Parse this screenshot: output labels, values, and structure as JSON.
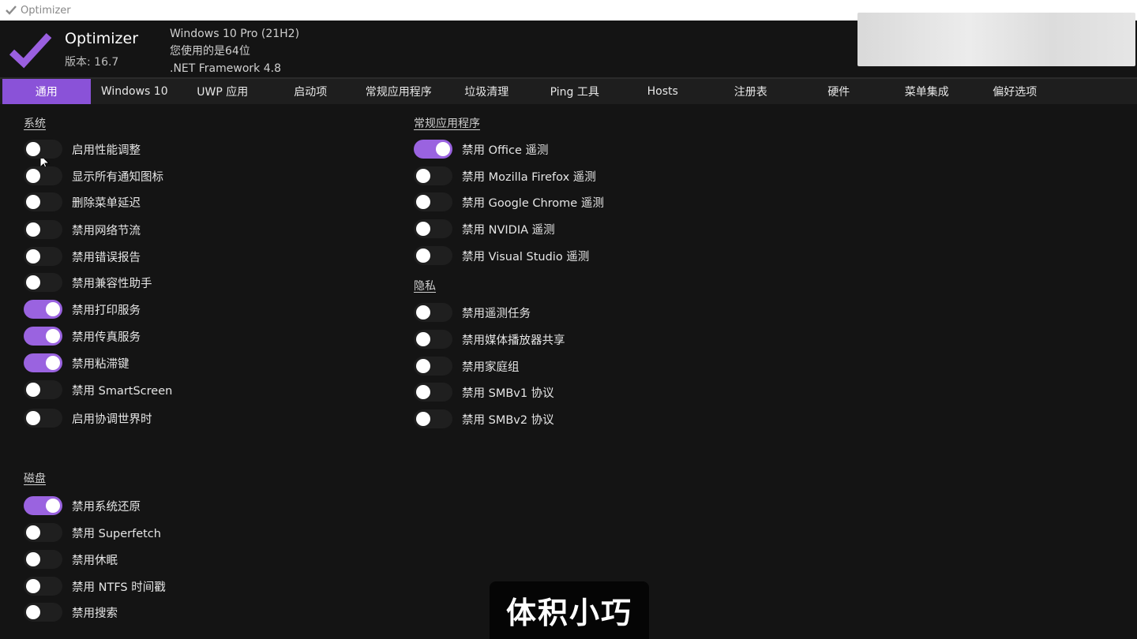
{
  "window": {
    "title": "Optimizer"
  },
  "header": {
    "app_name": "Optimizer",
    "version": "版本: 16.7",
    "os": "Windows 10 Pro (21H2)",
    "arch": "您使用的是64位",
    "framework": ".NET Framework 4.8"
  },
  "colors": {
    "accent": "#8a52d8",
    "toggle_on": "#9a63e0",
    "background": "#141414",
    "tab_strip": "#1e1e1e"
  },
  "tabs": [
    {
      "label": "通用",
      "active": true
    },
    {
      "label": "Windows 10",
      "active": false
    },
    {
      "label": "UWP 应用",
      "active": false
    },
    {
      "label": "启动项",
      "active": false
    },
    {
      "label": "常规应用程序",
      "active": false
    },
    {
      "label": "垃圾清理",
      "active": false
    },
    {
      "label": "Ping 工具",
      "active": false
    },
    {
      "label": "Hosts",
      "active": false
    },
    {
      "label": "注册表",
      "active": false
    },
    {
      "label": "硬件",
      "active": false
    },
    {
      "label": "菜单集成",
      "active": false
    },
    {
      "label": "偏好选项",
      "active": false
    }
  ],
  "sections": {
    "system": {
      "title": "系统",
      "items": [
        {
          "label": "启用性能调整",
          "on": false
        },
        {
          "label": "显示所有通知图标",
          "on": false
        },
        {
          "label": "删除菜单延迟",
          "on": false
        },
        {
          "label": "禁用网络节流",
          "on": false
        },
        {
          "label": "禁用错误报告",
          "on": false
        },
        {
          "label": "禁用兼容性助手",
          "on": false
        },
        {
          "label": "禁用打印服务",
          "on": true
        },
        {
          "label": "禁用传真服务",
          "on": true
        },
        {
          "label": "禁用粘滞键",
          "on": true
        },
        {
          "label": "禁用 SmartScreen",
          "on": false
        },
        {
          "label": "启用协调世界时",
          "on": false
        }
      ]
    },
    "disk": {
      "title": "磁盘",
      "items": [
        {
          "label": "禁用系统还原",
          "on": true
        },
        {
          "label": "禁用 Superfetch",
          "on": false
        },
        {
          "label": "禁用休眠",
          "on": false
        },
        {
          "label": "禁用 NTFS 时间戳",
          "on": false
        },
        {
          "label": "禁用搜索",
          "on": false
        }
      ]
    },
    "common_apps": {
      "title": "常规应用程序",
      "items": [
        {
          "label": "禁用 Office 遥测",
          "on": true
        },
        {
          "label": "禁用 Mozilla Firefox 遥测",
          "on": false
        },
        {
          "label": "禁用 Google Chrome 遥测",
          "on": false
        },
        {
          "label": "禁用 NVIDIA 遥测",
          "on": false
        },
        {
          "label": "禁用 Visual Studio 遥测",
          "on": false
        }
      ]
    },
    "privacy": {
      "title": "隐私",
      "items": [
        {
          "label": "禁用遥测任务",
          "on": false
        },
        {
          "label": "禁用媒体播放器共享",
          "on": false
        },
        {
          "label": "禁用家庭组",
          "on": false
        },
        {
          "label": "禁用 SMBv1 协议",
          "on": false
        },
        {
          "label": "禁用 SMBv2 协议",
          "on": false
        }
      ]
    }
  },
  "caption": "体积小巧"
}
